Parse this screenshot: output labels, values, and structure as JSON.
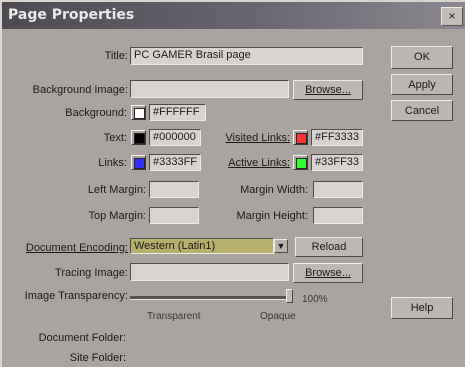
{
  "window": {
    "title": "Page Properties",
    "close": "×"
  },
  "fields": {
    "title": {
      "label": "Title:",
      "value": "PC GAMER Brasil page"
    },
    "background_image": {
      "label": "Background Image:",
      "value": "",
      "browse": "Browse..."
    },
    "background": {
      "label": "Background:",
      "value": "#FFFFFF",
      "color": "#FFFFFF"
    },
    "text": {
      "label": "Text:",
      "value": "#000000",
      "color": "#000000"
    },
    "links": {
      "label": "Links:",
      "value": "#3333FF",
      "color": "#3333FF"
    },
    "visited_links": {
      "label": "Visited Links:",
      "value": "#FF3333",
      "color": "#FF3333"
    },
    "active_links": {
      "label": "Active Links:",
      "value": "#33FF33",
      "color": "#33FF33"
    },
    "left_margin": {
      "label": "Left Margin:",
      "value": ""
    },
    "top_margin": {
      "label": "Top Margin:",
      "value": ""
    },
    "margin_width": {
      "label": "Margin Width:",
      "value": ""
    },
    "margin_height": {
      "label": "Margin Height:",
      "value": ""
    },
    "document_encoding": {
      "label": "Document Encoding:",
      "value": "Western (Latin1)",
      "reload": "Reload"
    },
    "tracing_image": {
      "label": "Tracing Image:",
      "value": "",
      "browse": "Browse..."
    },
    "image_transparency": {
      "label": "Image Transparency:",
      "percent_label": "100%",
      "level": 1.0,
      "left_caption": "Transparent",
      "right_caption": "Opaque"
    },
    "document_folder": {
      "label": "Document Folder:"
    },
    "site_folder": {
      "label": "Site Folder:"
    }
  },
  "buttons": {
    "ok": "OK",
    "apply": "Apply",
    "cancel": "Cancel",
    "help": "Help"
  }
}
